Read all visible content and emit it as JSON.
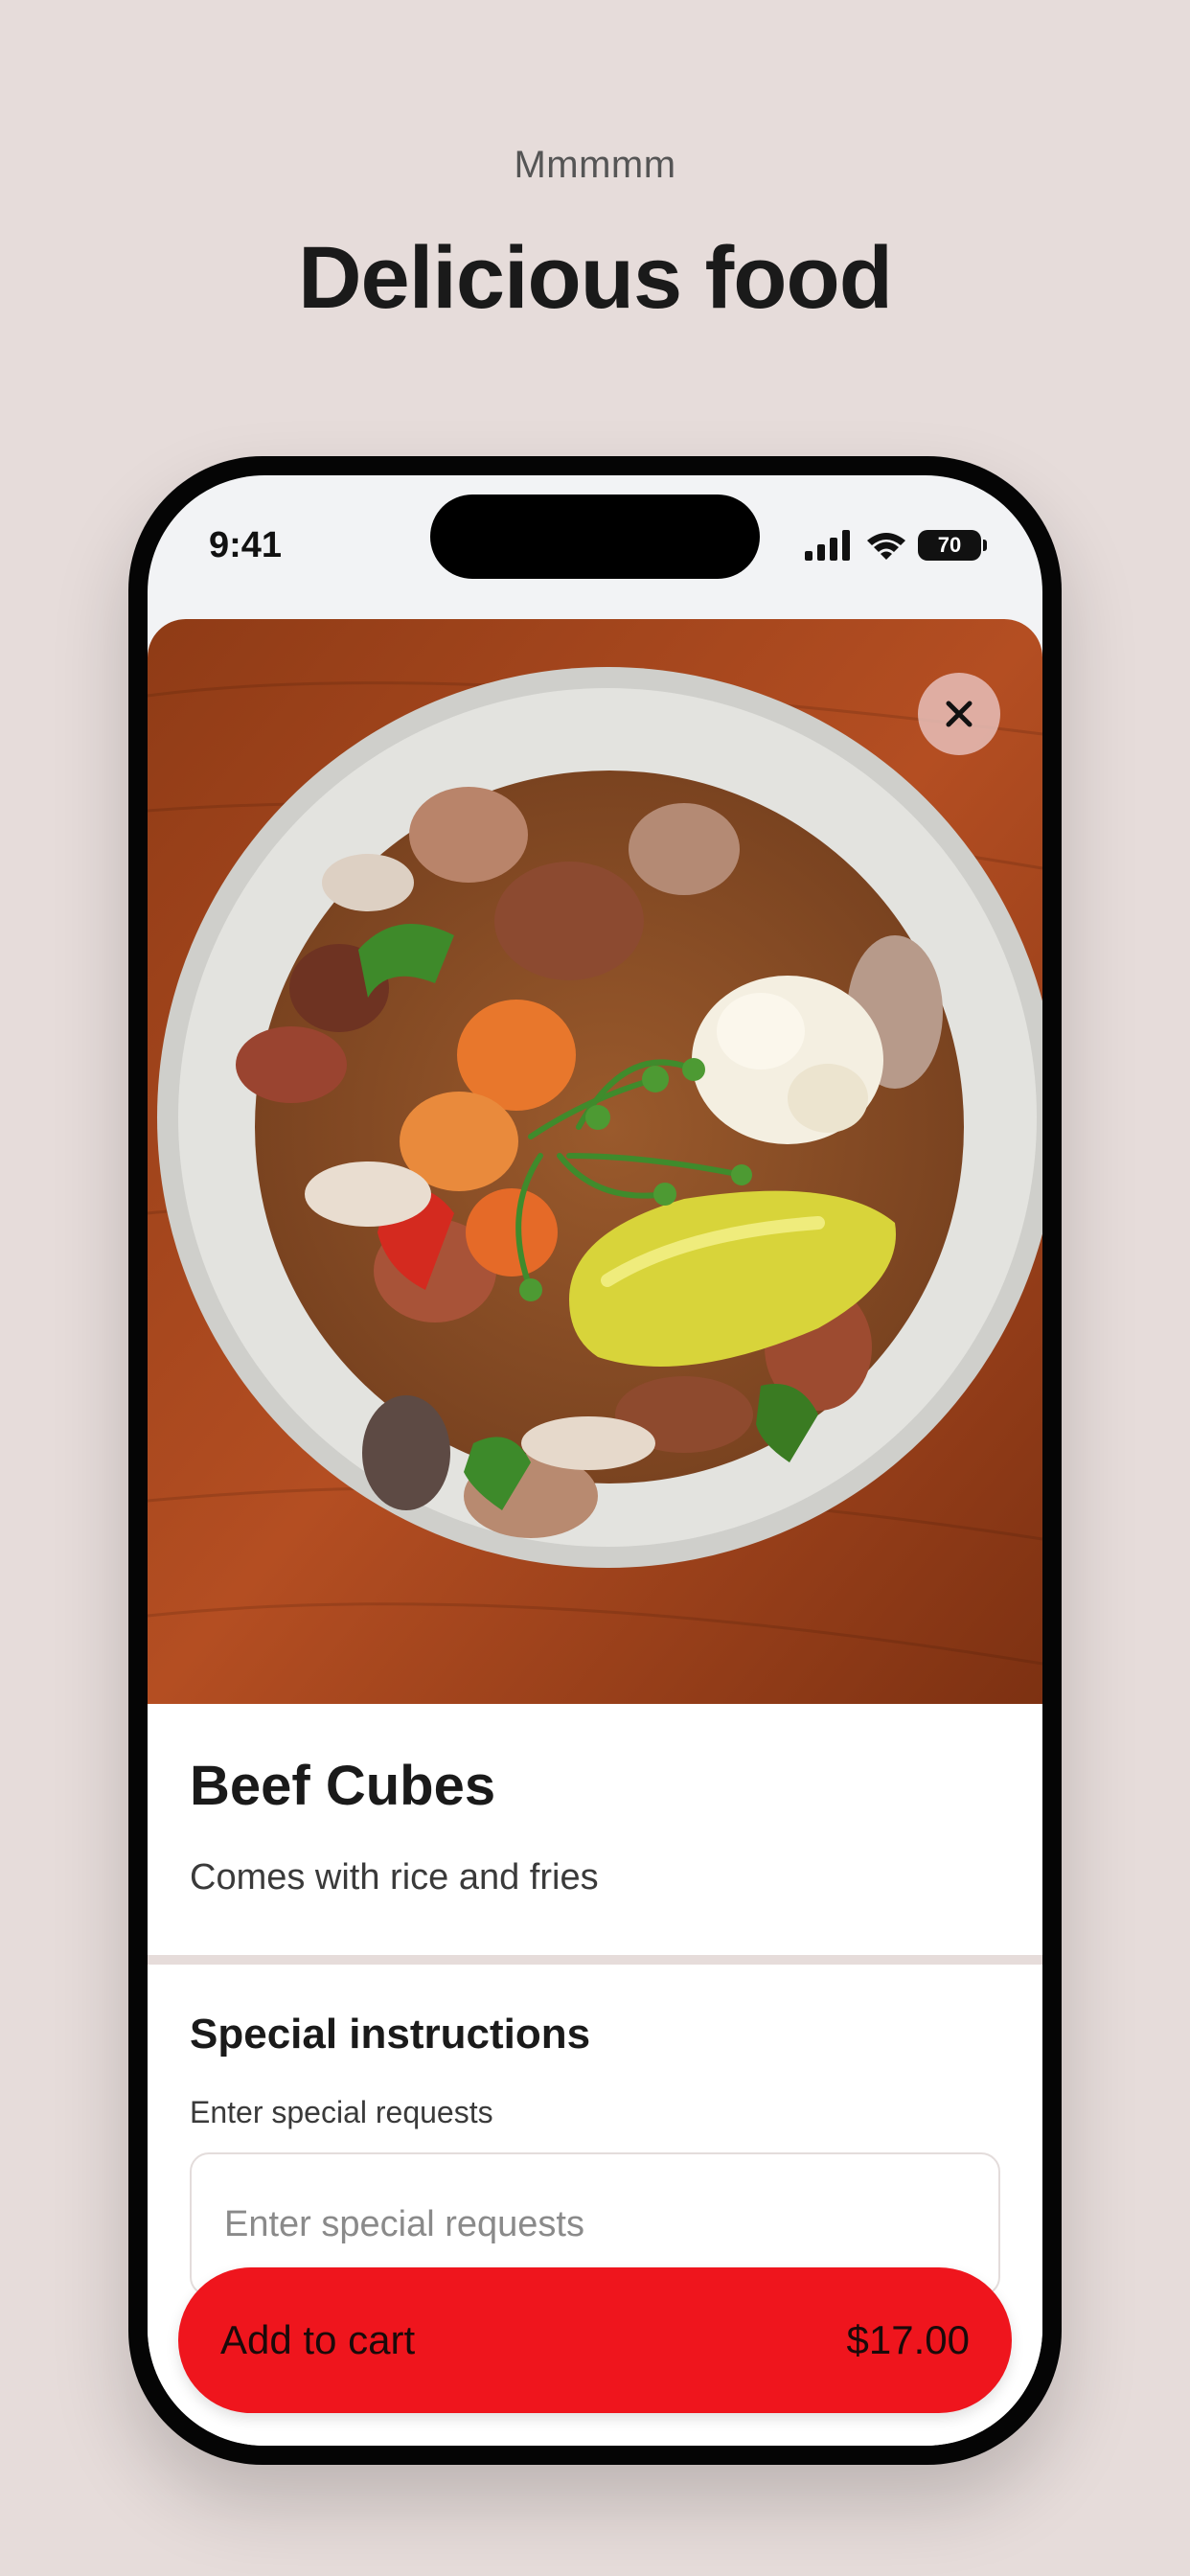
{
  "header": {
    "eyebrow": "Mmmmm",
    "title": "Delicious food"
  },
  "status_bar": {
    "time": "9:41",
    "battery": "70",
    "icons": [
      "signal-icon",
      "wifi-icon",
      "battery-icon"
    ]
  },
  "item": {
    "image": "food-photo-stew-bowl",
    "title": "Beef Cubes",
    "description": "Comes with rice and fries"
  },
  "instructions": {
    "title": "Special instructions",
    "subtitle": "Enter special requests",
    "placeholder": "Enter special requests"
  },
  "cart_button": {
    "label": "Add to cart",
    "price": "$17.00"
  },
  "colors": {
    "background": "#e6dcda",
    "accent": "#ef151d",
    "close_button": "#e6beb9"
  }
}
